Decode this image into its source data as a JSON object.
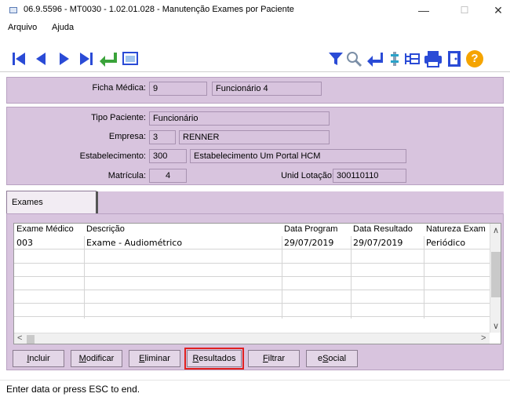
{
  "window": {
    "title": "06.9.5596 - MT0030 - 1.02.01.028 - Manutenção Exames por Paciente",
    "minimize": "—",
    "maximize": "☐",
    "close": "✕"
  },
  "menu": {
    "items": [
      "Arquivo",
      "Ajuda"
    ]
  },
  "toolbar": {
    "left_icons": [
      "first-record-icon",
      "previous-record-icon",
      "next-record-icon",
      "last-record-icon",
      "return-icon",
      "window-icon"
    ],
    "right_icons": [
      "filter-icon",
      "search-icon",
      "back-icon",
      "tools-icon",
      "tree-icon",
      "print-icon",
      "exit-icon",
      "help-icon"
    ],
    "help_glyph": "?"
  },
  "header": {
    "ficha_label": "Ficha Médica:",
    "ficha_value": "9",
    "ficha_name": "Funcionário 4"
  },
  "details": {
    "tipo_label": "Tipo Paciente:",
    "tipo_value": "Funcionário",
    "empresa_label": "Empresa:",
    "empresa_value": "3",
    "empresa_name": "RENNER",
    "estab_label": "Estabelecimento:",
    "estab_value": "300",
    "estab_name": "Estabelecimento Um Portal HCM",
    "matricula_label": "Matrícula:",
    "matricula_value": "4",
    "unid_label": "Unid Lotação:",
    "unid_value": "300110110"
  },
  "tab": {
    "label": "Exames"
  },
  "grid": {
    "columns": [
      "Exame Médico",
      "Descrição",
      "Data Program",
      "Data Resultado",
      "Natureza Exam"
    ],
    "rows": [
      [
        "003",
        "Exame - Audiométrico",
        "29/07/2019",
        "29/07/2019",
        "Periódico"
      ]
    ],
    "arrows": {
      "up": "∧",
      "down": "∨",
      "left": "<",
      "right": ">"
    }
  },
  "buttons": {
    "incluir_key": "I",
    "incluir_rest": "ncluir",
    "modificar_key": "M",
    "modificar_rest": "odificar",
    "eliminar_key": "E",
    "eliminar_rest": "liminar",
    "resultados_key": "R",
    "resultados_rest": "esultados",
    "filtrar_key": "F",
    "filtrar_rest": "iltrar",
    "esocial_pre": "e",
    "esocial_key": "S",
    "esocial_rest": "ocial"
  },
  "colors": {
    "accent_highlight": "#e02020",
    "panel": "#d8c4de"
  },
  "status": {
    "text": "Enter data or press ESC to end."
  }
}
